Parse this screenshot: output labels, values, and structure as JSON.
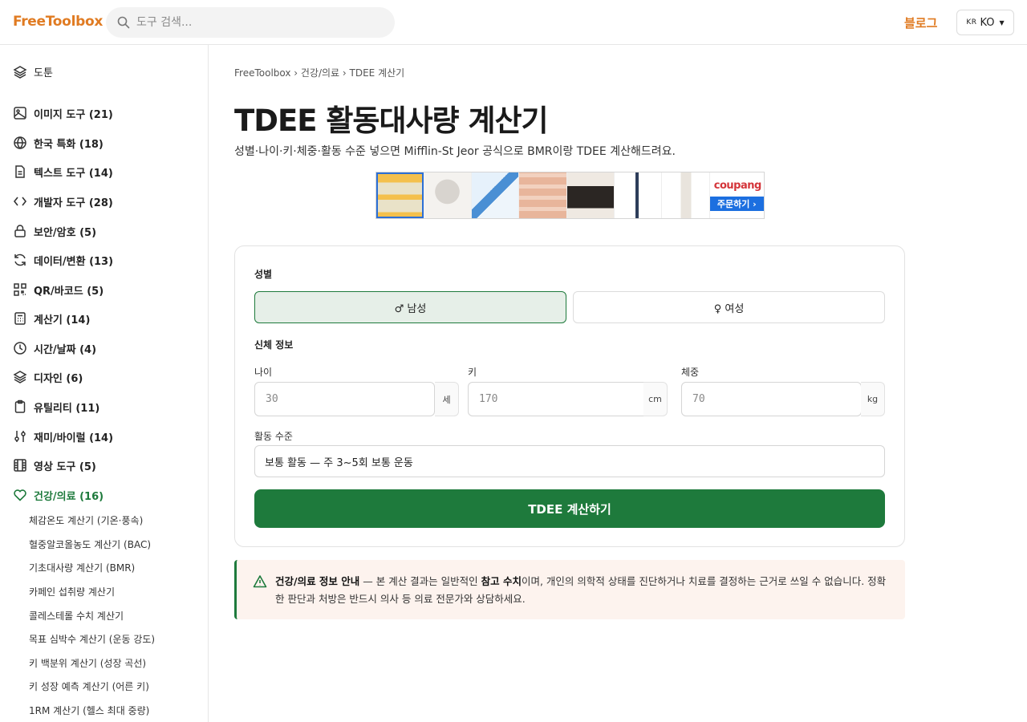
{
  "header": {
    "logo": "FreeToolbox",
    "search_placeholder": "도구 검색...",
    "blog_label": "블로그",
    "lang_flag": "KR",
    "lang_label": "KO"
  },
  "sidebar": {
    "top_label": "도툰",
    "categories": [
      {
        "label": "이미지 도구 (21)",
        "icon": "image-icon"
      },
      {
        "label": "한국 특화 (18)",
        "icon": "globe-icon"
      },
      {
        "label": "텍스트 도구 (14)",
        "icon": "document-icon"
      },
      {
        "label": "개발자 도구 (28)",
        "icon": "code-icon"
      },
      {
        "label": "보안/암호 (5)",
        "icon": "lock-icon"
      },
      {
        "label": "데이터/변환 (13)",
        "icon": "refresh-icon"
      },
      {
        "label": "QR/바코드 (5)",
        "icon": "qr-icon"
      },
      {
        "label": "계산기 (14)",
        "icon": "calculator-icon"
      },
      {
        "label": "시간/날짜 (4)",
        "icon": "clock-icon"
      },
      {
        "label": "디자인 (6)",
        "icon": "layers-icon"
      },
      {
        "label": "유틸리티 (11)",
        "icon": "clipboard-icon"
      },
      {
        "label": "재미/바이럴 (14)",
        "icon": "sliders-icon"
      },
      {
        "label": "영상 도구 (5)",
        "icon": "film-icon"
      },
      {
        "label": "건강/의료 (16)",
        "icon": "heart-icon",
        "active": true
      }
    ],
    "sub_items": [
      "체감온도 계산기 (기온·풍속)",
      "혈중알코올농도 계산기 (BAC)",
      "기초대사량 계산기 (BMR)",
      "카페인 섭취량 계산기",
      "콜레스테롤 수치 계산기",
      "목표 심박수 계산기 (운동 강도)",
      "키 백분위 계산기 (성장 곡선)",
      "키 성장 예측 계산기 (어른 키)",
      "1RM 계산기 (헬스 최대 중량)"
    ]
  },
  "main": {
    "breadcrumb": "FreeToolbox › 건강/의료 › TDEE 계산기",
    "title": "TDEE 활동대사량 계산기",
    "subtitle": "성별·나이·키·체중·활동 수준 넣으면 Mifflin-St Jeor 공식으로 BMR이랑 TDEE 계산해드려요.",
    "ad": {
      "brand": "coupang",
      "order_label": "주문하기 ›"
    },
    "form": {
      "gender_label": "성별",
      "male_label": "♂ 남성",
      "female_label": "♀ 여성",
      "body_label": "신체 정보",
      "age_label": "나이",
      "age_placeholder": "30",
      "age_unit": "세",
      "height_label": "키",
      "height_placeholder": "170",
      "height_unit": "cm",
      "weight_label": "체중",
      "weight_placeholder": "70",
      "weight_unit": "kg",
      "activity_label": "활동 수준",
      "activity_value": "보통 활동 — 주 3~5회 보통 운동",
      "submit_label": "TDEE 계산하기"
    },
    "notice": {
      "title": "건강/의료 정보 안내",
      "text_1": " — 본 계산 결과는 일반적인 ",
      "bold": "참고 수치",
      "text_2": "이며, 개인의 의학적 상태를 진단하거나 치료를 결정하는 근거로 쓰일 수 없습니다. 정확한 판단과 처방은 반드시 의사 등 의료 전문가와 상담하세요."
    }
  },
  "colors": {
    "brand_orange": "#e07b22",
    "primary_green": "#1e7a3c",
    "notice_bg": "#fdf3ee"
  }
}
